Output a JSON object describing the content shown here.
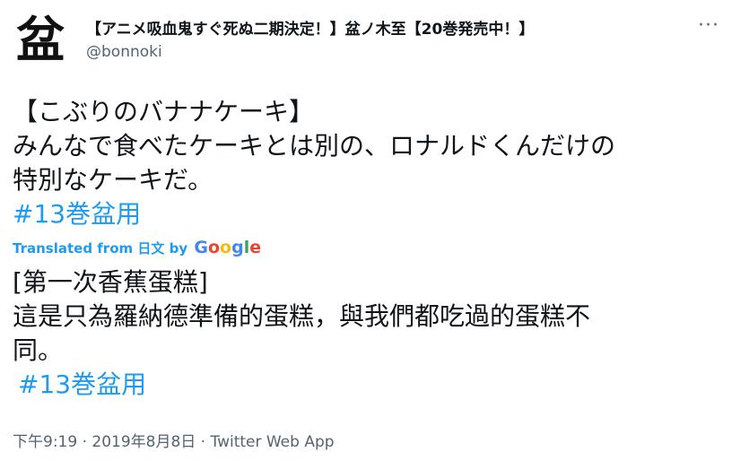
{
  "tweet": {
    "avatar_glyph": "盆",
    "display_name": "【アニメ吸血鬼すぐ死ぬ二期決定！】盆ノ木至【20巻発売中！】",
    "handle": "@bonnoki",
    "more_icon": "more-dots-icon",
    "original": {
      "line1": "【こぶりのバナナケーキ】",
      "line2": "みんなで食べたケーキとは別の、ロナルドくんだけの",
      "line3": "特別なケーキだ。",
      "hashtag": "#13巻盆用"
    },
    "translation_label": {
      "prefix": "Translated from",
      "language": "日文",
      "by": "by",
      "google_g": "G",
      "google_o1": "o",
      "google_o2": "o",
      "google_g2": "g",
      "google_l": "l",
      "google_e": "e"
    },
    "translation": {
      "line1": "[第一次香蕉蛋糕]",
      "line2": "這是只為羅納德準備的蛋糕，與我們都吃過的蛋糕不",
      "line3": "同。",
      "hashtag": "#13巻盆用"
    },
    "meta": "下午9:19 · 2019年8月8日 · Twitter Web App"
  },
  "colors": {
    "link": "#1d9bf0",
    "secondary": "#536471",
    "text": "#0f1419"
  }
}
